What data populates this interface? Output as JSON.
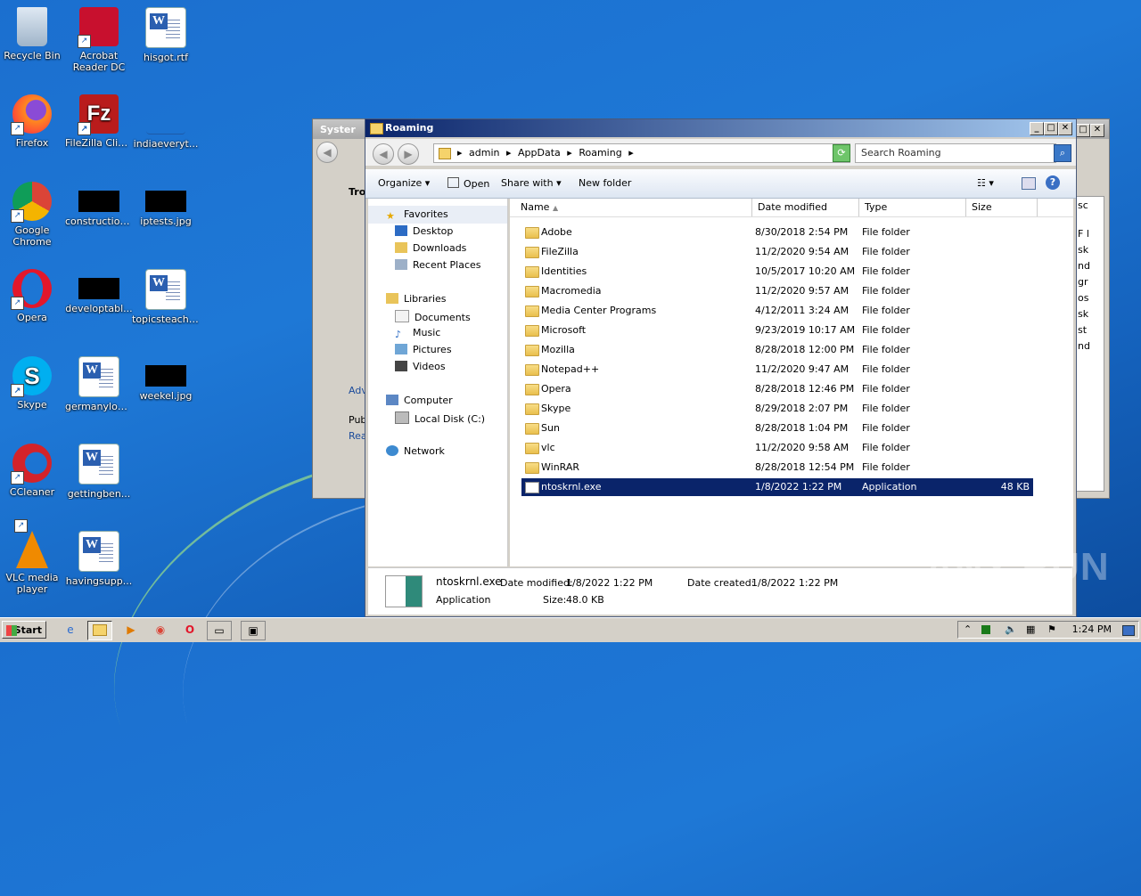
{
  "desktop_icons": [
    {
      "label": "Recycle Bin"
    },
    {
      "label": "Acrobat Reader DC"
    },
    {
      "label": "hisgot.rtf"
    },
    {
      "label": "Firefox"
    },
    {
      "label": "FileZilla Client"
    },
    {
      "label": "indiaeveryt..."
    },
    {
      "label": "Google Chrome"
    },
    {
      "label": "construction..."
    },
    {
      "label": "iptests.jpg"
    },
    {
      "label": "Opera"
    },
    {
      "label": "developtabl..."
    },
    {
      "label": "topicsteachi..."
    },
    {
      "label": "Skype"
    },
    {
      "label": "germanyloa..."
    },
    {
      "label": "weekel.jpg"
    },
    {
      "label": "CCleaner"
    },
    {
      "label": "gettingben..."
    },
    {
      "label": "VLC media player"
    },
    {
      "label": "havingsupp..."
    }
  ],
  "background_window": {
    "title": "Syster",
    "text_tro": "Tro",
    "text_adv": "Adv",
    "text_pub": "Pub",
    "text_rea": "Rea",
    "right_fragments": [
      "sc",
      "F l",
      "sk",
      "nd",
      "gr",
      "os",
      "sk",
      "st",
      "nd"
    ]
  },
  "explorer": {
    "title": "Roaming",
    "breadcrumb": [
      "admin",
      "AppData",
      "Roaming"
    ],
    "search_placeholder": "Search Roaming",
    "toolbar": {
      "organize": "Organize",
      "open": "Open",
      "share_with": "Share with",
      "new_folder": "New folder"
    },
    "nav": {
      "favorites": "Favorites",
      "desktop": "Desktop",
      "downloads": "Downloads",
      "recent": "Recent Places",
      "libraries": "Libraries",
      "documents": "Documents",
      "music": "Music",
      "pictures": "Pictures",
      "videos": "Videos",
      "computer": "Computer",
      "local_disk": "Local Disk (C:)",
      "network": "Network"
    },
    "columns": {
      "name": "Name",
      "date": "Date modified",
      "type": "Type",
      "size": "Size"
    },
    "files": [
      {
        "name": "Adobe",
        "date": "8/30/2018 2:54 PM",
        "type": "File folder",
        "size": ""
      },
      {
        "name": "FileZilla",
        "date": "11/2/2020 9:54 AM",
        "type": "File folder",
        "size": ""
      },
      {
        "name": "Identities",
        "date": "10/5/2017 10:20 AM",
        "type": "File folder",
        "size": ""
      },
      {
        "name": "Macromedia",
        "date": "11/2/2020 9:57 AM",
        "type": "File folder",
        "size": ""
      },
      {
        "name": "Media Center Programs",
        "date": "4/12/2011 3:24 AM",
        "type": "File folder",
        "size": ""
      },
      {
        "name": "Microsoft",
        "date": "9/23/2019 10:17 AM",
        "type": "File folder",
        "size": ""
      },
      {
        "name": "Mozilla",
        "date": "8/28/2018 12:00 PM",
        "type": "File folder",
        "size": ""
      },
      {
        "name": "Notepad++",
        "date": "11/2/2020 9:47 AM",
        "type": "File folder",
        "size": ""
      },
      {
        "name": "Opera",
        "date": "8/28/2018 12:46 PM",
        "type": "File folder",
        "size": ""
      },
      {
        "name": "Skype",
        "date": "8/29/2018 2:07 PM",
        "type": "File folder",
        "size": ""
      },
      {
        "name": "Sun",
        "date": "8/28/2018 1:04 PM",
        "type": "File folder",
        "size": ""
      },
      {
        "name": "vlc",
        "date": "11/2/2020 9:58 AM",
        "type": "File folder",
        "size": ""
      },
      {
        "name": "WinRAR",
        "date": "8/28/2018 12:54 PM",
        "type": "File folder",
        "size": ""
      },
      {
        "name": "ntoskrnl.exe",
        "date": "1/8/2022 1:22 PM",
        "type": "Application",
        "size": "48 KB",
        "selected": true
      }
    ],
    "details": {
      "name": "ntoskrnl.exe",
      "type": "Application",
      "modified_label": "Date modified:",
      "modified": "1/8/2022 1:22 PM",
      "created_label": "Date created:",
      "created": "1/8/2022 1:22 PM",
      "size_label": "Size:",
      "size": "48.0 KB"
    }
  },
  "taskbar": {
    "start": "Start",
    "clock": "1:24 PM"
  },
  "watermark": "ANY RUN"
}
